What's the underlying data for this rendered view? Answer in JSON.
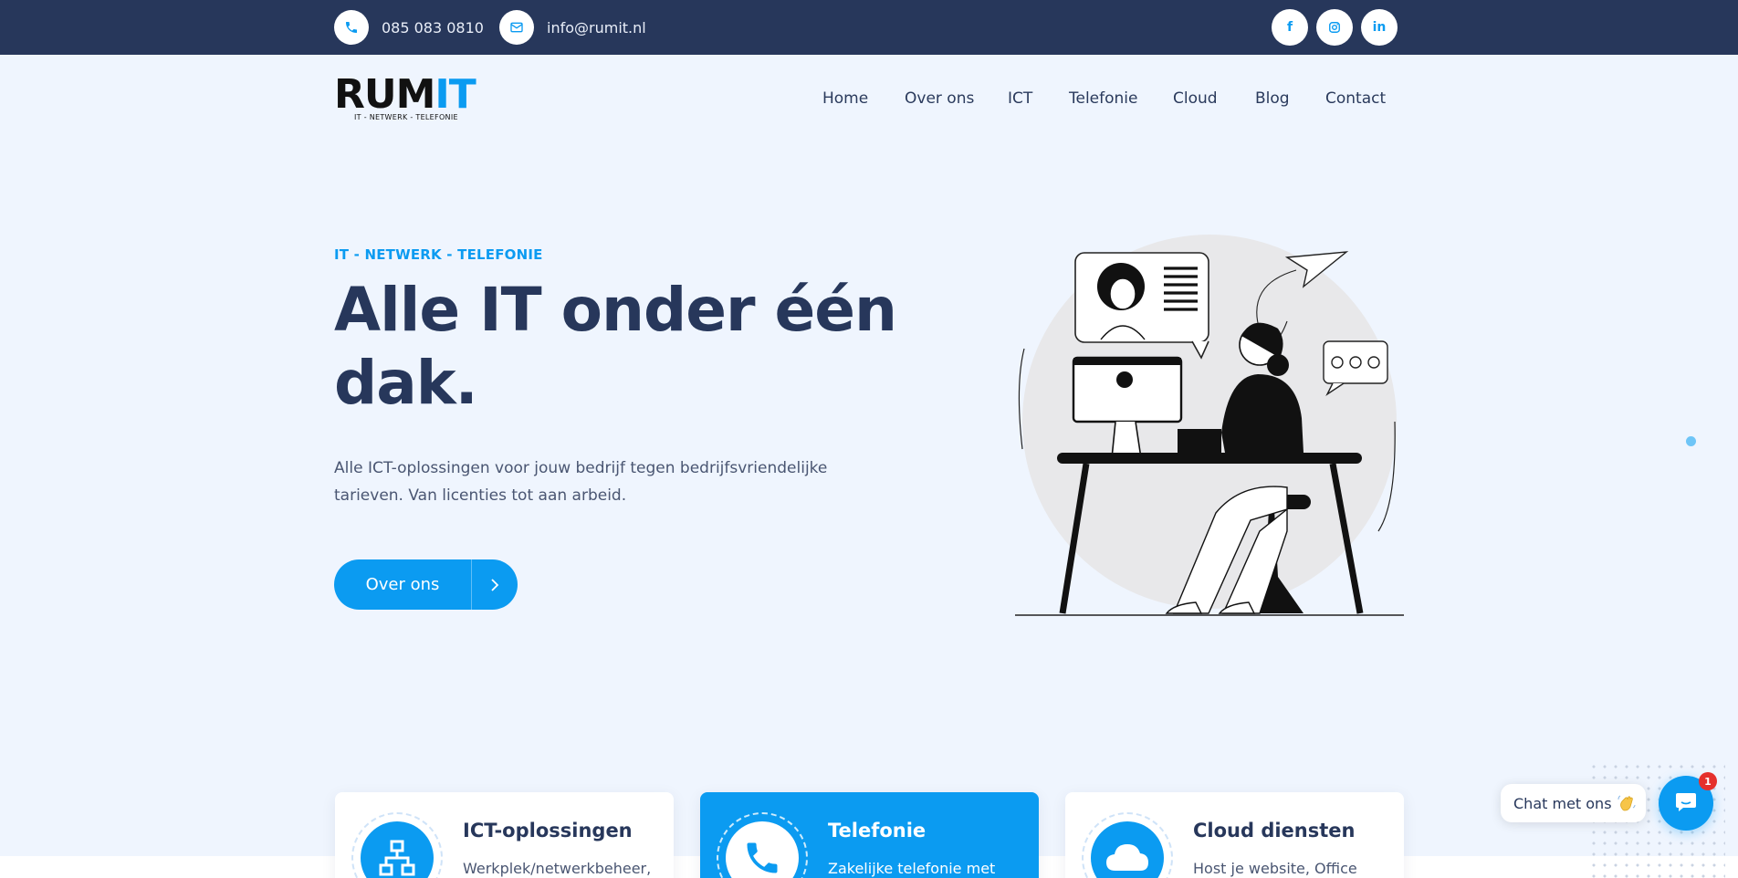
{
  "topbar": {
    "phone": "085 083 0810",
    "email": "info@rumit.nl",
    "phone_icon": "phone-icon",
    "email_icon": "envelope-icon",
    "socials": [
      {
        "name": "facebook-icon",
        "glyph": "f"
      },
      {
        "name": "instagram-icon",
        "glyph": "◎"
      },
      {
        "name": "linkedin-icon",
        "glyph": "in"
      }
    ]
  },
  "logo": {
    "main_part1": "RUM",
    "main_part2": "IT",
    "tagline": "IT - NETWERK - TELEFONIE"
  },
  "nav": {
    "items": [
      "Home",
      "Over ons",
      "ICT",
      "Telefonie",
      "Cloud",
      "Blog",
      "Contact"
    ]
  },
  "hero": {
    "eyebrow": "IT - NETWERK - TELEFONIE",
    "headline": "Alle IT onder één dak.",
    "lead": "Alle ICT-oplossingen voor jouw bedrijf tegen bedrijfsvriendelijke tarieven. Van licenties tot aan arbeid.",
    "cta_label": "Over ons"
  },
  "cards": [
    {
      "title": "ICT-oplossingen",
      "desc": "Werkplek/netwerkbeheer,",
      "icon": "network-icon",
      "active": false
    },
    {
      "title": "Telefonie",
      "desc": "Zakelijke telefonie met",
      "icon": "phone-icon",
      "active": true
    },
    {
      "title": "Cloud diensten",
      "desc": "Host je website, Office",
      "icon": "cloud-icon",
      "active": false
    }
  ],
  "chat": {
    "label": "Chat met ons",
    "badge": "1"
  },
  "colors": {
    "navy": "#27375b",
    "accent": "#0b9bf1",
    "background": "#eff5fe",
    "badge": "#e5302c"
  }
}
